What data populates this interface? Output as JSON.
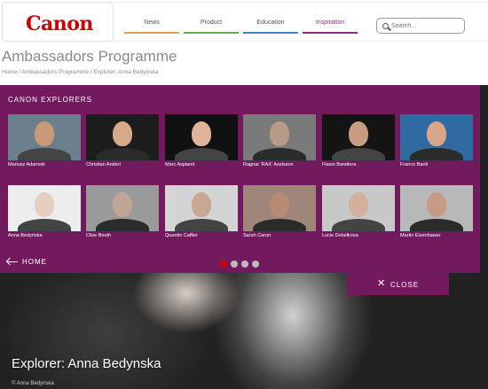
{
  "logo": {
    "text": "Canon"
  },
  "nav": {
    "items": [
      {
        "label": "News",
        "color": "#e0a04a"
      },
      {
        "label": "Product",
        "color": "#6aa84f"
      },
      {
        "label": "Education",
        "color": "#3d85c6"
      },
      {
        "label": "Inspiration",
        "color": "#8e2a7c"
      }
    ]
  },
  "search": {
    "placeholder": "Search..."
  },
  "page": {
    "title": "Ambassadors Programme"
  },
  "breadcrumb": {
    "items": [
      "Home",
      "Ambassadors Programme",
      "Explorer: Anna Bedyńska"
    ],
    "separator": " / "
  },
  "overlay": {
    "heading": "CANON EXPLORERS",
    "background": "#731a5f",
    "explorers": [
      {
        "name": "Mariusz Adamski",
        "bg": "#6c7f8c"
      },
      {
        "name": "Christian Anderl",
        "bg": "#1c1c1c"
      },
      {
        "name": "Marc Aspland",
        "bg": "#111111"
      },
      {
        "name": "Ragnar 'RAX' Axelsson",
        "bg": "#7a7a7a"
      },
      {
        "name": "Flavio Bandiera",
        "bg": "#141414"
      },
      {
        "name": "Franco Banfi",
        "bg": "#2f6aa0"
      },
      {
        "name": "Anna Bedyńska",
        "bg": "#ededed"
      },
      {
        "name": "Clive Booth",
        "bg": "#9a9a9a"
      },
      {
        "name": "Quentin Caffier",
        "bg": "#d4d4d4"
      },
      {
        "name": "Sarah Caron",
        "bg": "#a0867a"
      },
      {
        "name": "Lucie Debelkova",
        "bg": "#c8c8c8"
      },
      {
        "name": "Martin Eisenhawer",
        "bg": "#b8b8b8"
      }
    ],
    "home_label": "HOME",
    "pagination": {
      "count": 4,
      "active": 0
    },
    "close_label": "CLOSE"
  },
  "hero": {
    "title": "Explorer: Anna Bedynska",
    "credit": "© Anna Bedyńska"
  },
  "icons": {
    "search": "search-icon",
    "back": "arrow-left-icon",
    "close": "close-icon"
  }
}
